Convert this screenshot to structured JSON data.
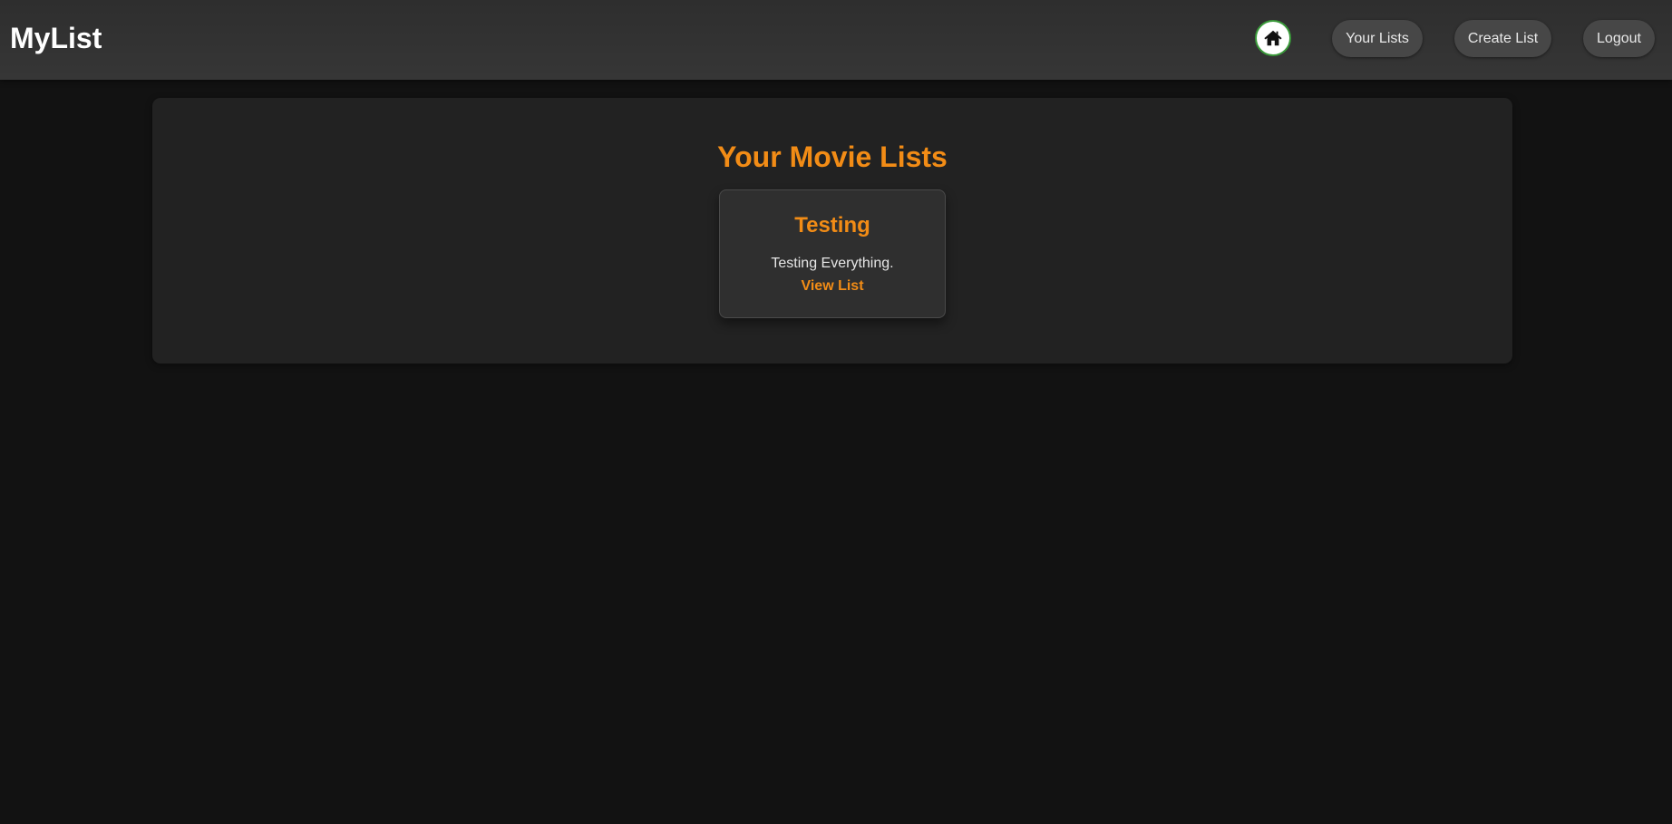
{
  "header": {
    "brand": "MyList",
    "home_icon": "home-icon",
    "nav": {
      "your_lists": "Your Lists",
      "create_list": "Create List",
      "logout": "Logout"
    }
  },
  "main": {
    "title": "Your Movie Lists",
    "lists": [
      {
        "name": "Testing",
        "description": "Testing Everything.",
        "link_label": "View List"
      }
    ]
  },
  "colors": {
    "accent": "#f28c16",
    "background": "#121212",
    "panel": "#222222",
    "header": "#333333",
    "home_ring": "#3a9a3a"
  }
}
